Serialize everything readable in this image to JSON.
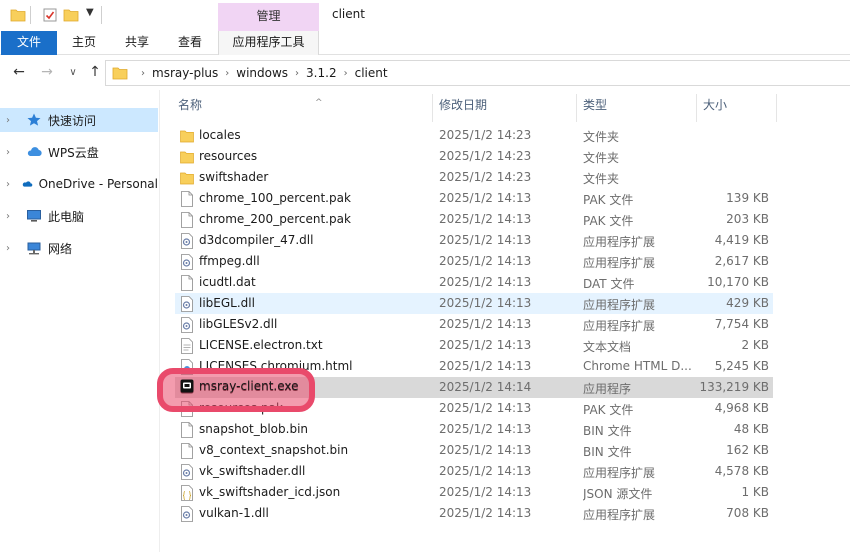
{
  "window": {
    "title": "client"
  },
  "ribbon": {
    "context_group": "管理",
    "tabs": [
      {
        "label": "文件",
        "active": true
      },
      {
        "label": "主页"
      },
      {
        "label": "共享"
      },
      {
        "label": "查看"
      },
      {
        "label": "应用程序工具"
      }
    ]
  },
  "address": {
    "crumbs": [
      "msray-plus",
      "windows",
      "3.1.2",
      "client"
    ]
  },
  "navpane": {
    "items": [
      {
        "label": "快速访问",
        "icon": "star-icon",
        "selected": true
      },
      {
        "label": "WPS云盘",
        "icon": "cloud-icon"
      },
      {
        "label": "OneDrive - Personal",
        "icon": "onedrive-icon"
      },
      {
        "label": "此电脑",
        "icon": "computer-icon"
      },
      {
        "label": "网络",
        "icon": "network-icon"
      }
    ]
  },
  "columns": {
    "name": "名称",
    "date": "修改日期",
    "type": "类型",
    "size": "大小"
  },
  "files": [
    {
      "name": "locales",
      "date": "2025/1/2 14:23",
      "type": "文件夹",
      "size": "",
      "icon": "folder-icon"
    },
    {
      "name": "resources",
      "date": "2025/1/2 14:23",
      "type": "文件夹",
      "size": "",
      "icon": "folder-icon"
    },
    {
      "name": "swiftshader",
      "date": "2025/1/2 14:23",
      "type": "文件夹",
      "size": "",
      "icon": "folder-icon"
    },
    {
      "name": "chrome_100_percent.pak",
      "date": "2025/1/2 14:13",
      "type": "PAK 文件",
      "size": "139 KB",
      "icon": "file-icon"
    },
    {
      "name": "chrome_200_percent.pak",
      "date": "2025/1/2 14:13",
      "type": "PAK 文件",
      "size": "203 KB",
      "icon": "file-icon"
    },
    {
      "name": "d3dcompiler_47.dll",
      "date": "2025/1/2 14:13",
      "type": "应用程序扩展",
      "size": "4,419 KB",
      "icon": "dll-icon"
    },
    {
      "name": "ffmpeg.dll",
      "date": "2025/1/2 14:13",
      "type": "应用程序扩展",
      "size": "2,617 KB",
      "icon": "dll-icon"
    },
    {
      "name": "icudtl.dat",
      "date": "2025/1/2 14:13",
      "type": "DAT 文件",
      "size": "10,170 KB",
      "icon": "file-icon"
    },
    {
      "name": "libEGL.dll",
      "date": "2025/1/2 14:13",
      "type": "应用程序扩展",
      "size": "429 KB",
      "icon": "dll-icon",
      "state": "hover"
    },
    {
      "name": "libGLESv2.dll",
      "date": "2025/1/2 14:13",
      "type": "应用程序扩展",
      "size": "7,754 KB",
      "icon": "dll-icon"
    },
    {
      "name": "LICENSE.electron.txt",
      "date": "2025/1/2 14:13",
      "type": "文本文档",
      "size": "2 KB",
      "icon": "text-file-icon"
    },
    {
      "name": "LICENSES.chromium.html",
      "date": "2025/1/2 14:13",
      "type": "Chrome HTML D...",
      "size": "5,245 KB",
      "icon": "html-file-icon"
    },
    {
      "name": "msray-client.exe",
      "date": "2025/1/2 14:14",
      "type": "应用程序",
      "size": "133,219 KB",
      "icon": "exe-icon",
      "state": "selected"
    },
    {
      "name": "resources.pak",
      "date": "2025/1/2 14:13",
      "type": "PAK 文件",
      "size": "4,968 KB",
      "icon": "file-icon"
    },
    {
      "name": "snapshot_blob.bin",
      "date": "2025/1/2 14:13",
      "type": "BIN 文件",
      "size": "48 KB",
      "icon": "file-icon"
    },
    {
      "name": "v8_context_snapshot.bin",
      "date": "2025/1/2 14:13",
      "type": "BIN 文件",
      "size": "162 KB",
      "icon": "file-icon"
    },
    {
      "name": "vk_swiftshader.dll",
      "date": "2025/1/2 14:13",
      "type": "应用程序扩展",
      "size": "4,578 KB",
      "icon": "dll-icon"
    },
    {
      "name": "vk_swiftshader_icd.json",
      "date": "2025/1/2 14:13",
      "type": "JSON 源文件",
      "size": "1 KB",
      "icon": "json-file-icon"
    },
    {
      "name": "vulkan-1.dll",
      "date": "2025/1/2 14:13",
      "type": "应用程序扩展",
      "size": "708 KB",
      "icon": "dll-icon"
    }
  ],
  "colors": {
    "file_tab": "#1a6fc9",
    "context_group": "#f1d5f4",
    "selected": "#cce8ff",
    "annotation": "#e94a6b"
  }
}
